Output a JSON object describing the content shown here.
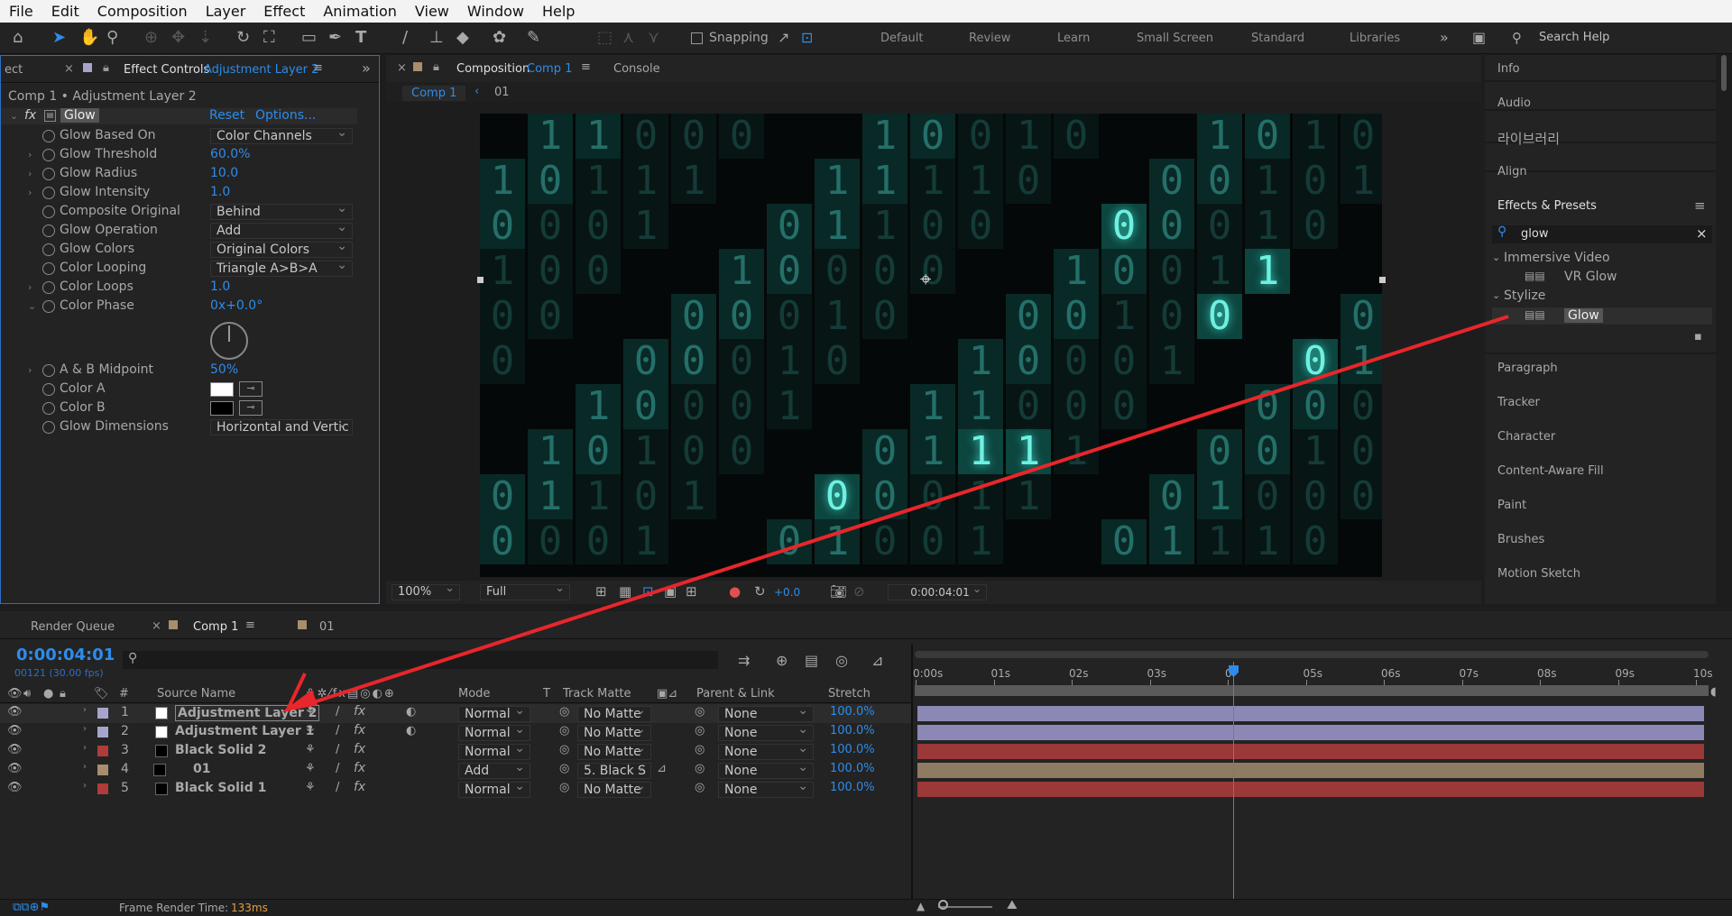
{
  "menu": [
    "File",
    "Edit",
    "Composition",
    "Layer",
    "Effect",
    "Animation",
    "View",
    "Window",
    "Help"
  ],
  "toolbar": {
    "snapping": "Snapping",
    "workspaces": [
      "Default",
      "Review",
      "Learn",
      "Small Screen",
      "Standard",
      "Libraries"
    ],
    "search_placeholder": "Search Help"
  },
  "effect_controls": {
    "tab_left": "ect",
    "tab_title": "Effect Controls",
    "tab_layer": "Adjustment Layer 2",
    "crumb": "Comp 1 • Adjustment Layer 2",
    "effect_name": "Glow",
    "reset": "Reset",
    "options": "Options...",
    "props": [
      {
        "name": "Glow Based On",
        "value": "Color Channels",
        "type": "drop"
      },
      {
        "name": "Glow Threshold",
        "value": "60.0%",
        "type": "num"
      },
      {
        "name": "Glow Radius",
        "value": "10.0",
        "type": "num"
      },
      {
        "name": "Glow Intensity",
        "value": "1.0",
        "type": "num"
      },
      {
        "name": "Composite Original",
        "value": "Behind",
        "type": "drop"
      },
      {
        "name": "Glow Operation",
        "value": "Add",
        "type": "drop"
      },
      {
        "name": "Glow Colors",
        "value": "Original Colors",
        "type": "drop"
      },
      {
        "name": "Color Looping",
        "value": "Triangle A>B>A",
        "type": "drop"
      },
      {
        "name": "Color Loops",
        "value": "1.0",
        "type": "num"
      },
      {
        "name": "Color Phase",
        "value": "0x+0.0°",
        "type": "num"
      },
      {
        "name": "A & B Midpoint",
        "value": "50%",
        "type": "num"
      },
      {
        "name": "Color A",
        "value": "",
        "type": "color"
      },
      {
        "name": "Color B",
        "value": "",
        "type": "color"
      },
      {
        "name": "Glow Dimensions",
        "value": "Horizontal and Vertic",
        "type": "drop"
      }
    ]
  },
  "composition": {
    "tab_title": "Composition",
    "tab_comp": "Comp 1",
    "console": "Console",
    "crumb1": "Comp 1",
    "crumb2": "01",
    "zoom": "100%",
    "quality": "Full",
    "exposure": "+0.0",
    "timecode": "0:00:04:01"
  },
  "right_panel": {
    "items": [
      "Info",
      "Audio",
      "라이브러리",
      "Align"
    ],
    "effects_title": "Effects & Presets",
    "search_value": "glow",
    "tree": [
      {
        "label": "Immersive Video"
      },
      {
        "label": "VR Glow"
      },
      {
        "label": "Stylize"
      },
      {
        "label": "Glow"
      }
    ],
    "items2": [
      "Paragraph",
      "Tracker",
      "Character",
      "Content-Aware Fill",
      "Paint",
      "Brushes",
      "Motion Sketch"
    ]
  },
  "timeline": {
    "tabs": [
      "Render Queue",
      "Comp 1",
      "01"
    ],
    "timecode": "0:00:04:01",
    "fps": "00121 (30.00 fps)",
    "headers": {
      "num": "#",
      "source": "Source Name",
      "mode": "Mode",
      "t": "T",
      "matte": "Track Matte",
      "parent": "Parent & Link",
      "stretch": "Stretch"
    },
    "ruler": [
      "0:00s",
      "01s",
      "02s",
      "03s",
      "0",
      "05s",
      "06s",
      "07s",
      "08s",
      "09s",
      "10s"
    ],
    "layers": [
      {
        "n": "1",
        "name": "Adjustment Layer 2",
        "mode": "Normal",
        "matte": "No Matte",
        "parent": "None",
        "stretch": "100.0%",
        "label": "#a7a4cc"
      },
      {
        "n": "2",
        "name": "Adjustment Layer 1",
        "mode": "Normal",
        "matte": "No Matte",
        "parent": "None",
        "stretch": "100.0%",
        "label": "#a7a4cc"
      },
      {
        "n": "3",
        "name": "Black Solid 2",
        "mode": "Normal",
        "matte": "No Matte",
        "parent": "None",
        "stretch": "100.0%",
        "label": "#b03b3b"
      },
      {
        "n": "4",
        "name": "01",
        "mode": "Add",
        "matte": "5. Black S",
        "parent": "None",
        "stretch": "100.0%",
        "label": "#a88d6e"
      },
      {
        "n": "5",
        "name": "Black Solid 1",
        "mode": "Normal",
        "matte": "No Matte",
        "parent": "None",
        "stretch": "100.0%",
        "label": "#b03b3b"
      }
    ],
    "status": "Frame Render Time:",
    "render_time": "133ms"
  }
}
